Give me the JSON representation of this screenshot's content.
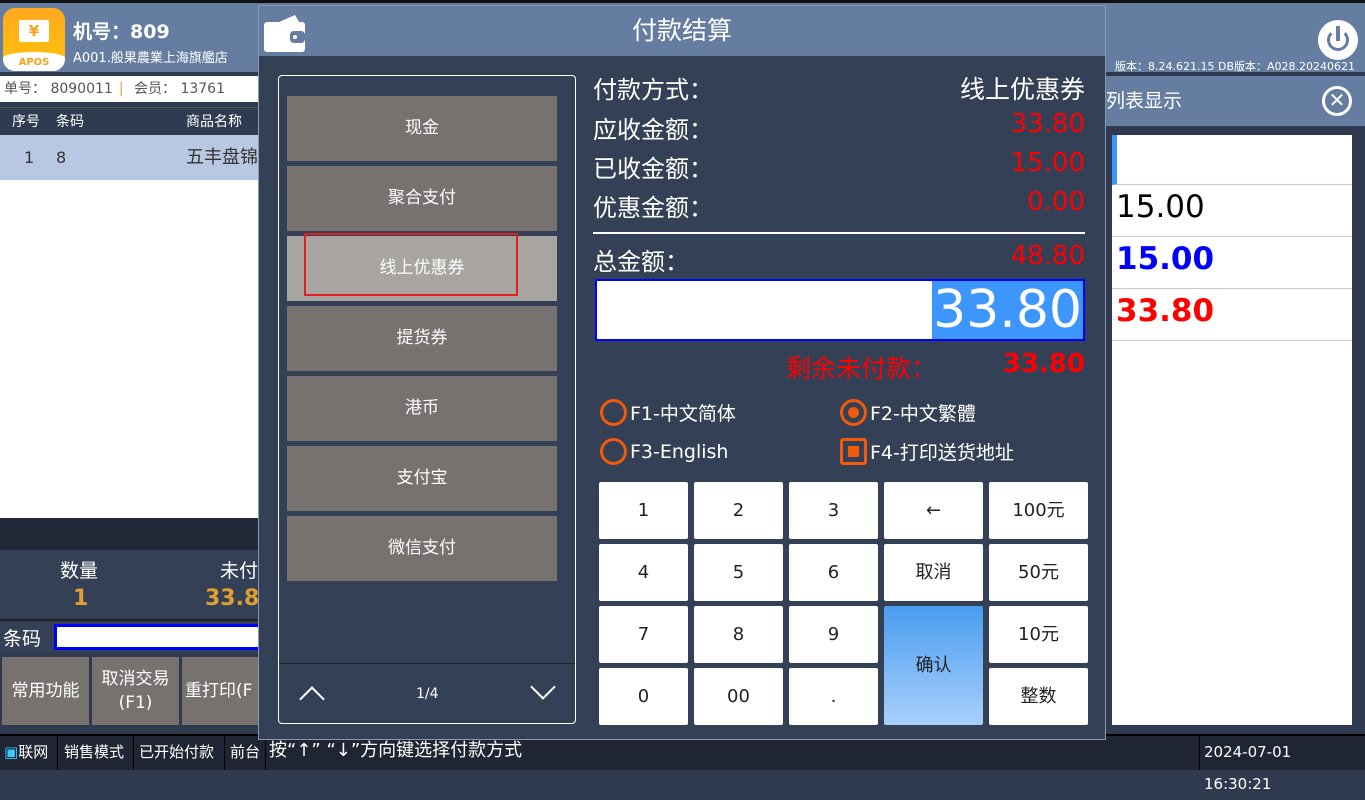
{
  "header": {
    "machine": "机号：809",
    "store": "A001.般果農業上海旗艦店",
    "logo_text": "APOS",
    "logo_symbol": "¥",
    "version": "版本：8.24.621.15 DB版本：A028.20240621"
  },
  "order": {
    "number_label": "单号：",
    "number": "8090011",
    "member_label": "会员：",
    "member": "13761"
  },
  "table": {
    "headers": [
      "序号",
      "条码",
      "商品名称"
    ],
    "rows": [
      {
        "seq": "1",
        "barcode": "8",
        "name": "五丰盘锦"
      }
    ]
  },
  "stats": {
    "qty_label": "数量",
    "qty": "1",
    "unpaid_label": "未付",
    "unpaid": "33.8"
  },
  "barcode_label": "条码",
  "func_buttons": [
    "常用功能",
    "取消交易\n(F1)",
    "重打印(F"
  ],
  "statusbar": {
    "network": "联网",
    "mode": "销售模式",
    "state": "已开始付款",
    "front": "前台",
    "datetime": "2024-07-01 16:30:21"
  },
  "right_panel": {
    "title": "列表显示",
    "values": [
      {
        "text": "15.00",
        "color": "#000000"
      },
      {
        "text": "15.00",
        "color": "#0000ff"
      },
      {
        "text": "33.80",
        "color": "#ff0000"
      }
    ]
  },
  "modal": {
    "title": "付款结算",
    "pay_methods": [
      "现金",
      "聚合支付",
      "线上优惠券",
      "提货券",
      "港币",
      "支付宝",
      "微信支付"
    ],
    "selected_index": 2,
    "page": "1/4",
    "hint": "按“↑”  “↓”方向键选择付款方式",
    "summary": [
      {
        "label": "付款方式：",
        "value": "线上优惠券",
        "color": "#ffffff"
      },
      {
        "label": "应收金额：",
        "value": "33.80",
        "color": "#ff0000"
      },
      {
        "label": "已收金额：",
        "value": "15.00",
        "color": "#ff0000"
      },
      {
        "label": "优惠金额：",
        "value": "0.00",
        "color": "#ff0000"
      }
    ],
    "total_label": "总金额：",
    "total": "48.80",
    "input_value": "33.80",
    "remain_label": "剩余未付款：",
    "remain": "33.80",
    "options": [
      {
        "label": "F1-中文简体",
        "type": "radio",
        "checked": false
      },
      {
        "label": "F2-中文繁體",
        "type": "radio",
        "checked": true
      },
      {
        "label": "F3-English",
        "type": "radio",
        "checked": false
      },
      {
        "label": "F4-打印送货地址",
        "type": "checkbox",
        "checked": true
      }
    ],
    "keys": [
      "1",
      "2",
      "3",
      "←",
      "100元",
      "4",
      "5",
      "6",
      "取消",
      "50元",
      "7",
      "8",
      "9",
      "确认",
      "10元",
      "0",
      "00",
      ".",
      "整数"
    ]
  }
}
